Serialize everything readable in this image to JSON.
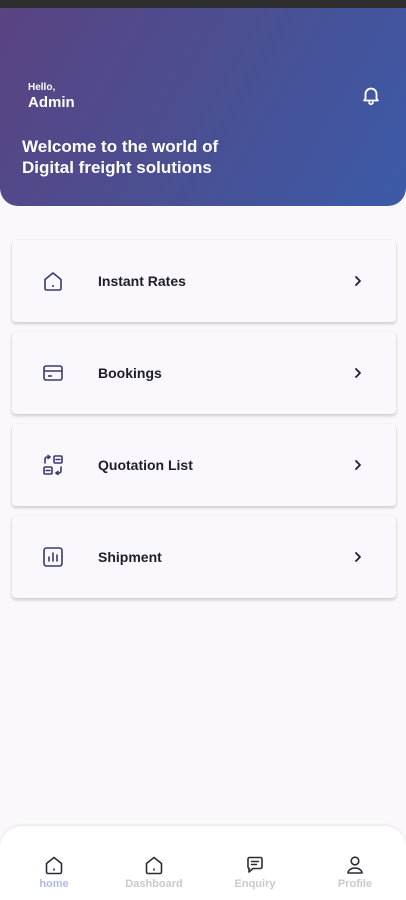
{
  "header": {
    "hello": "Hello,",
    "user_name": "Admin",
    "welcome_line1": "Welcome to the world of",
    "welcome_line2": "Digital freight solutions",
    "gradient_start": "#5a4382",
    "gradient_end": "#3c5aa8"
  },
  "menu": {
    "items": [
      {
        "label": "Instant Rates",
        "icon": "home-icon"
      },
      {
        "label": "Bookings",
        "icon": "card-icon"
      },
      {
        "label": "Quotation List",
        "icon": "quotation-icon"
      },
      {
        "label": "Shipment",
        "icon": "chart-icon"
      }
    ],
    "icon_color": "#3a3870"
  },
  "bottom_nav": {
    "items": [
      {
        "label": "home",
        "icon": "home-icon",
        "active": true
      },
      {
        "label": "Dashboard",
        "icon": "dashboard-icon",
        "active": false
      },
      {
        "label": "Enquiry",
        "icon": "chat-icon",
        "active": false
      },
      {
        "label": "Profile",
        "icon": "user-icon",
        "active": false
      }
    ],
    "active_color": "#b3b8ee",
    "inactive_color": "#c9c9cf"
  }
}
